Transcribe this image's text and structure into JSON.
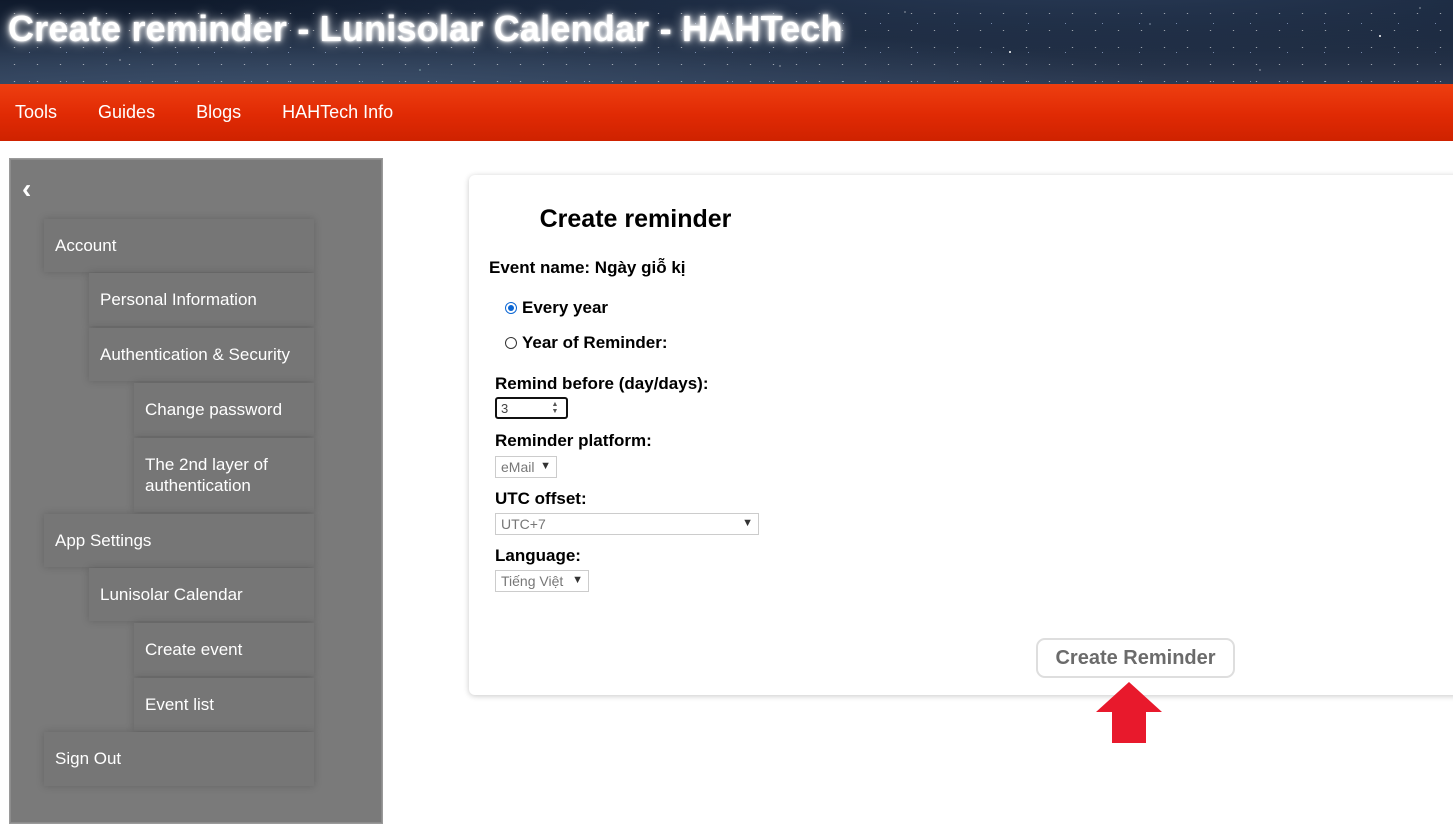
{
  "site": {
    "title": "Create reminder - Lunisolar Calendar - HAHTech"
  },
  "nav": {
    "items": [
      "Tools",
      "Guides",
      "Blogs",
      "HAHTech Info"
    ]
  },
  "sidebar": {
    "collapse_icon": "‹",
    "items": [
      {
        "label": "Account"
      },
      {
        "label": "Personal Information"
      },
      {
        "label": "Authentication & Security"
      },
      {
        "label": "Change password"
      },
      {
        "label": "The 2nd layer of authentication"
      },
      {
        "label": "App Settings"
      },
      {
        "label": "Lunisolar Calendar"
      },
      {
        "label": "Create event"
      },
      {
        "label": "Event list"
      },
      {
        "label": "Sign Out"
      }
    ]
  },
  "form": {
    "title": "Create reminder",
    "event_name": "Event name: Ngày giỗ kị",
    "repeat_options": [
      {
        "label": "Every year",
        "selected": true
      },
      {
        "label": "Year of Reminder:",
        "selected": false
      }
    ],
    "remind_before": {
      "label": "Remind before (day/days):",
      "value": "3"
    },
    "platform": {
      "label": "Reminder platform:",
      "value": "eMail"
    },
    "utc": {
      "label": "UTC offset:",
      "value": "UTC+7"
    },
    "language": {
      "label": "Language:",
      "value": "Tiếng Việt"
    },
    "submit_label": "Create Reminder"
  },
  "colors": {
    "nav_red": "#e02a04",
    "sidebar_gray": "#7a7a7a",
    "radio_blue": "#0b66d4",
    "arrow_red": "#e8192c"
  },
  "icons": {
    "back": "chevron-left-icon",
    "arrow": "up-arrow-icon",
    "select": "chevron-down-icon"
  }
}
